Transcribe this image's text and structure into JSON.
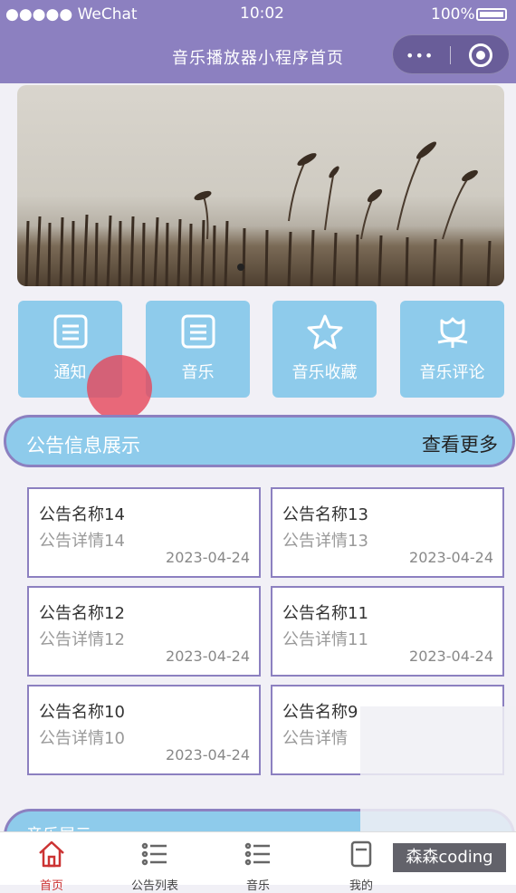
{
  "status": {
    "carrier": "●●●●● WeChat",
    "time": "10:02",
    "battery": "100%"
  },
  "navbar": {
    "title": "音乐播放器小程序首页",
    "more_icon": "•••"
  },
  "menu": [
    {
      "label": "通知",
      "icon": "notice-icon"
    },
    {
      "label": "音乐",
      "icon": "music-icon"
    },
    {
      "label": "音乐收藏",
      "icon": "star-icon"
    },
    {
      "label": "音乐评论",
      "icon": "tulip-icon"
    }
  ],
  "notice_section": {
    "title": "公告信息展示",
    "more": "查看更多",
    "items": [
      {
        "name": "公告名称14",
        "detail": "公告详情14",
        "date": "2023-04-24"
      },
      {
        "name": "公告名称13",
        "detail": "公告详情13",
        "date": "2023-04-24"
      },
      {
        "name": "公告名称12",
        "detail": "公告详情12",
        "date": "2023-04-24"
      },
      {
        "name": "公告名称11",
        "detail": "公告详情11",
        "date": "2023-04-24"
      },
      {
        "name": "公告名称10",
        "detail": "公告详情10",
        "date": "2023-04-24"
      },
      {
        "name": "公告名称9",
        "detail": "公告详情",
        "date": ""
      }
    ]
  },
  "section2": {
    "title": "音乐展示"
  },
  "tabbar": [
    {
      "label": "首页",
      "active": true
    },
    {
      "label": "公告列表"
    },
    {
      "label": "音乐"
    },
    {
      "label": "我的"
    }
  ],
  "watermark": "森森coding",
  "colors": {
    "primary": "#8c80c0",
    "accent": "#8ecbeb",
    "active_tab": "#cc3333"
  }
}
